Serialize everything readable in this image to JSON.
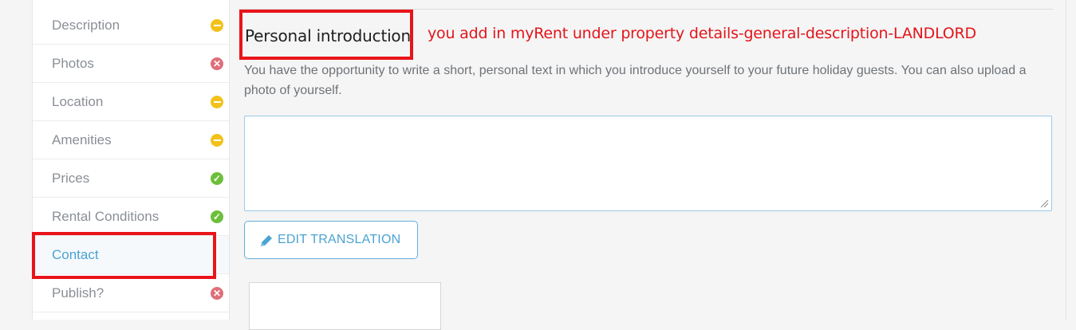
{
  "sidebar": {
    "items": [
      {
        "label": "Description",
        "status": "partial"
      },
      {
        "label": "Photos",
        "status": "error"
      },
      {
        "label": "Location",
        "status": "partial"
      },
      {
        "label": "Amenities",
        "status": "partial"
      },
      {
        "label": "Prices",
        "status": "ok"
      },
      {
        "label": "Rental Conditions",
        "status": "ok"
      },
      {
        "label": "Contact",
        "status": "active"
      },
      {
        "label": "Publish?",
        "status": "error"
      }
    ]
  },
  "section": {
    "title": "Personal introduction",
    "description": "You have the opportunity to write a short, personal text in which you introduce yourself to your future holiday guests. You can also upload a photo of yourself.",
    "textarea_value": "",
    "edit_translation_label": "EDIT TRANSLATION"
  },
  "annotation": {
    "note": "you add in myRent under property details-general-description-LANDLORD",
    "color": "#e8141a"
  },
  "colors": {
    "accent": "#4aa3d3",
    "status_partial": "#f2c21b",
    "status_error": "#de6f7a",
    "status_ok": "#6bbf3a"
  }
}
